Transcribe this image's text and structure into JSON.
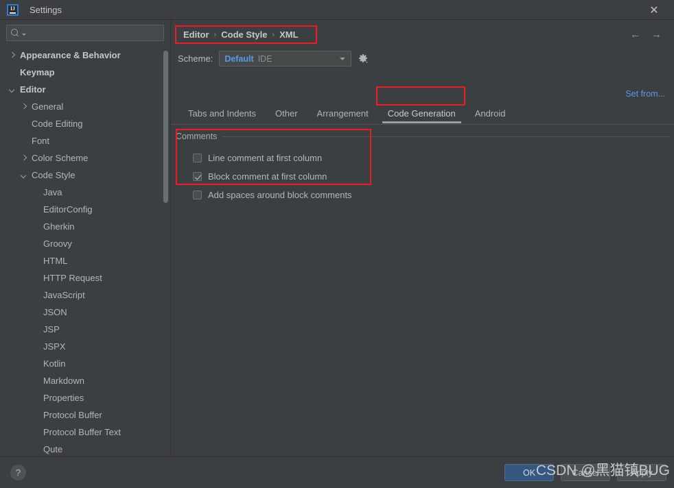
{
  "window": {
    "title": "Settings",
    "logo_icon": "intellij-idea-logo",
    "close_icon": "close-icon"
  },
  "sidebar": {
    "search": {
      "placeholder": "",
      "value": "",
      "icon": "search-icon"
    },
    "items": [
      {
        "label": "Appearance & Behavior",
        "indent": 0,
        "arrow": "right",
        "bold": true
      },
      {
        "label": "Keymap",
        "indent": 0,
        "arrow": "none",
        "bold": true
      },
      {
        "label": "Editor",
        "indent": 0,
        "arrow": "down",
        "bold": true
      },
      {
        "label": "General",
        "indent": 1,
        "arrow": "right",
        "bold": false
      },
      {
        "label": "Code Editing",
        "indent": 1,
        "arrow": "none",
        "bold": false
      },
      {
        "label": "Font",
        "indent": 1,
        "arrow": "none",
        "bold": false
      },
      {
        "label": "Color Scheme",
        "indent": 1,
        "arrow": "right",
        "bold": false
      },
      {
        "label": "Code Style",
        "indent": 1,
        "arrow": "down",
        "bold": false
      },
      {
        "label": "Java",
        "indent": 2,
        "arrow": "none",
        "bold": false
      },
      {
        "label": "EditorConfig",
        "indent": 2,
        "arrow": "none",
        "bold": false
      },
      {
        "label": "Gherkin",
        "indent": 2,
        "arrow": "none",
        "bold": false
      },
      {
        "label": "Groovy",
        "indent": 2,
        "arrow": "none",
        "bold": false
      },
      {
        "label": "HTML",
        "indent": 2,
        "arrow": "none",
        "bold": false
      },
      {
        "label": "HTTP Request",
        "indent": 2,
        "arrow": "none",
        "bold": false
      },
      {
        "label": "JavaScript",
        "indent": 2,
        "arrow": "none",
        "bold": false
      },
      {
        "label": "JSON",
        "indent": 2,
        "arrow": "none",
        "bold": false
      },
      {
        "label": "JSP",
        "indent": 2,
        "arrow": "none",
        "bold": false
      },
      {
        "label": "JSPX",
        "indent": 2,
        "arrow": "none",
        "bold": false
      },
      {
        "label": "Kotlin",
        "indent": 2,
        "arrow": "none",
        "bold": false
      },
      {
        "label": "Markdown",
        "indent": 2,
        "arrow": "none",
        "bold": false
      },
      {
        "label": "Properties",
        "indent": 2,
        "arrow": "none",
        "bold": false
      },
      {
        "label": "Protocol Buffer",
        "indent": 2,
        "arrow": "none",
        "bold": false
      },
      {
        "label": "Protocol Buffer Text",
        "indent": 2,
        "arrow": "none",
        "bold": false
      },
      {
        "label": "Qute",
        "indent": 2,
        "arrow": "none",
        "bold": false
      }
    ]
  },
  "content": {
    "breadcrumb": {
      "parts": [
        "Editor",
        "Code Style",
        "XML"
      ],
      "separator": "›"
    },
    "nav": {
      "back_icon": "arrow-left-icon",
      "forward_icon": "arrow-right-icon"
    },
    "scheme": {
      "label": "Scheme:",
      "value": "Default",
      "sub": "IDE",
      "gear_icon": "gear-icon",
      "caret_icon": "chevron-down-icon"
    },
    "set_from_link": "Set from...",
    "tabs": [
      {
        "label": "Tabs and Indents",
        "active": false
      },
      {
        "label": "Other",
        "active": false
      },
      {
        "label": "Arrangement",
        "active": false
      },
      {
        "label": "Code Generation",
        "active": true
      },
      {
        "label": "Android",
        "active": false
      }
    ],
    "group_title": "Comments",
    "checkboxes": [
      {
        "label": "Line comment at first column",
        "checked": false
      },
      {
        "label": "Block comment at first column",
        "checked": true
      },
      {
        "label": "Add spaces around block comments",
        "checked": false
      }
    ]
  },
  "footer": {
    "help_label": "?",
    "buttons": [
      {
        "label": "OK",
        "style": "primary"
      },
      {
        "label": "Cancel",
        "style": "normal"
      },
      {
        "label": "Apply",
        "style": "normal"
      }
    ]
  },
  "watermark": "CSDN @黑猫镇BUG",
  "colors": {
    "accent_blue": "#5a9ae4",
    "annotation_red": "#ee1b24",
    "primary_button": "#365880",
    "background": "#3c3f41"
  }
}
